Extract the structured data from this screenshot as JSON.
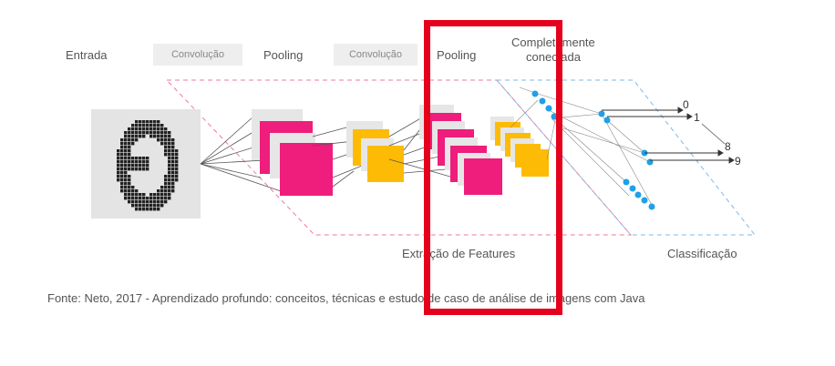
{
  "labels": {
    "entrada": "Entrada",
    "conv1": "Convolução",
    "pool1": "Pooling",
    "conv2": "Convolução",
    "pool2": "Pooling",
    "full_line1": "Completamente",
    "full_line2": "conectada",
    "feature_extraction": "Extração de Features",
    "classification": "Classificação"
  },
  "outputs": [
    "0",
    "1",
    "8",
    "9"
  ],
  "source": "Fonte: Neto, 2017 - Aprendizado profundo: conceitos, técnicas e estudo de caso de análise de imagens com Java",
  "colors": {
    "magenta": "#ef1d7c",
    "orange": "#fdbb06",
    "blue_node": "#1ea1e7",
    "highlight_red": "#e5001b",
    "pink_dash": "#f07a9a",
    "blue_dash": "#7fb8e8"
  }
}
